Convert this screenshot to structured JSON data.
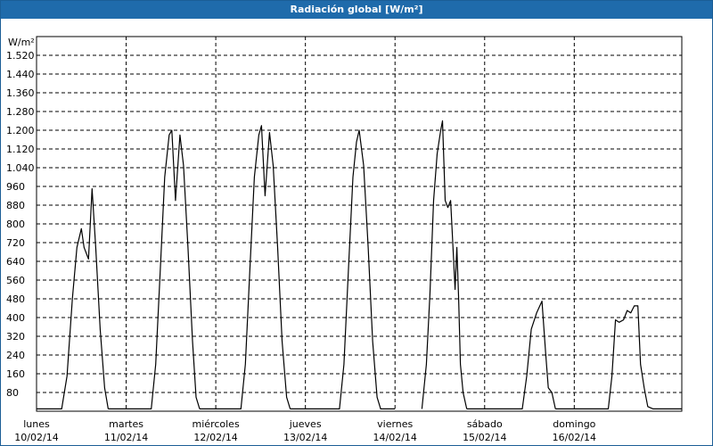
{
  "window": {
    "title": "Radiación global [W/m²]"
  },
  "chart_data": {
    "type": "line",
    "title": "Radiación global [W/m²]",
    "ylabel": "W/m²",
    "ylim": [
      0,
      1600
    ],
    "xlim": [
      0,
      7.2
    ],
    "grid": true,
    "yticks": [
      {
        "value": 80,
        "label": "80"
      },
      {
        "value": 160,
        "label": "160"
      },
      {
        "value": 240,
        "label": "240"
      },
      {
        "value": 320,
        "label": "320"
      },
      {
        "value": 400,
        "label": "400"
      },
      {
        "value": 480,
        "label": "480"
      },
      {
        "value": 560,
        "label": "560"
      },
      {
        "value": 640,
        "label": "640"
      },
      {
        "value": 720,
        "label": "720"
      },
      {
        "value": 800,
        "label": "800"
      },
      {
        "value": 880,
        "label": "880"
      },
      {
        "value": 960,
        "label": "960"
      },
      {
        "value": 1040,
        "label": "1.040"
      },
      {
        "value": 1120,
        "label": "1.120"
      },
      {
        "value": 1200,
        "label": "1.200"
      },
      {
        "value": 1280,
        "label": "1.280"
      },
      {
        "value": 1360,
        "label": "1.360"
      },
      {
        "value": 1440,
        "label": "1.440"
      },
      {
        "value": 1520,
        "label": "1.520"
      }
    ],
    "xticks": [
      {
        "pos": 0,
        "day": "lunes",
        "date": "10/02/14"
      },
      {
        "pos": 1,
        "day": "martes",
        "date": "11/02/14"
      },
      {
        "pos": 2,
        "day": "miércoles",
        "date": "12/02/14"
      },
      {
        "pos": 3,
        "day": "jueves",
        "date": "13/02/14"
      },
      {
        "pos": 4,
        "day": "viernes",
        "date": "14/02/14"
      },
      {
        "pos": 5,
        "day": "sábado",
        "date": "15/02/14"
      },
      {
        "pos": 6,
        "day": "domingo",
        "date": "16/02/14"
      }
    ],
    "series": [
      {
        "color": "#000000",
        "segments": [
          [
            [
              0,
              10
            ],
            [
              0.28,
              10
            ],
            [
              0.34,
              150
            ],
            [
              0.4,
              480
            ],
            [
              0.45,
              700
            ],
            [
              0.5,
              780
            ],
            [
              0.53,
              700
            ],
            [
              0.58,
              650
            ],
            [
              0.62,
              950
            ],
            [
              0.66,
              700
            ],
            [
              0.71,
              350
            ],
            [
              0.76,
              100
            ],
            [
              0.8,
              10
            ]
          ],
          [
            [
              0.8,
              10
            ],
            [
              1.28,
              10
            ],
            [
              1.33,
              200
            ],
            [
              1.38,
              600
            ],
            [
              1.43,
              1000
            ],
            [
              1.48,
              1180
            ],
            [
              1.51,
              1200
            ],
            [
              1.55,
              900
            ],
            [
              1.6,
              1180
            ],
            [
              1.64,
              1050
            ],
            [
              1.69,
              700
            ],
            [
              1.74,
              300
            ],
            [
              1.78,
              60
            ],
            [
              1.82,
              10
            ]
          ],
          [
            [
              1.82,
              10
            ],
            [
              2.28,
              10
            ],
            [
              2.33,
              200
            ],
            [
              2.38,
              600
            ],
            [
              2.43,
              1000
            ],
            [
              2.48,
              1180
            ],
            [
              2.51,
              1220
            ],
            [
              2.55,
              920
            ],
            [
              2.6,
              1190
            ],
            [
              2.64,
              1050
            ],
            [
              2.69,
              700
            ],
            [
              2.74,
              300
            ],
            [
              2.79,
              60
            ],
            [
              2.83,
              10
            ]
          ],
          [
            [
              2.83,
              10
            ],
            [
              3.38,
              10
            ],
            [
              3.43,
              200
            ],
            [
              3.48,
              600
            ],
            [
              3.53,
              1000
            ],
            [
              3.57,
              1150
            ],
            [
              3.6,
              1200
            ],
            [
              3.65,
              1050
            ],
            [
              3.7,
              700
            ],
            [
              3.75,
              300
            ],
            [
              3.8,
              60
            ],
            [
              3.84,
              10
            ],
            [
              4.0,
              10
            ]
          ],
          [
            [
              4.3,
              10
            ],
            [
              4.35,
              200
            ],
            [
              4.39,
              500
            ],
            [
              4.43,
              900
            ],
            [
              4.47,
              1100
            ],
            [
              4.51,
              1200
            ],
            [
              4.53,
              1240
            ],
            [
              4.56,
              900
            ],
            [
              4.59,
              870
            ],
            [
              4.62,
              900
            ],
            [
              4.64,
              750
            ],
            [
              4.67,
              520
            ],
            [
              4.69,
              700
            ],
            [
              4.71,
              480
            ],
            [
              4.73,
              200
            ],
            [
              4.76,
              80
            ],
            [
              4.8,
              10
            ]
          ],
          [
            [
              4.8,
              10
            ],
            [
              5.42,
              10
            ],
            [
              5.47,
              150
            ],
            [
              5.52,
              350
            ],
            [
              5.58,
              420
            ],
            [
              5.64,
              470
            ],
            [
              5.68,
              250
            ],
            [
              5.71,
              100
            ],
            [
              5.75,
              80
            ],
            [
              5.79,
              10
            ]
          ],
          [
            [
              5.79,
              10
            ],
            [
              6.38,
              10
            ],
            [
              6.42,
              150
            ],
            [
              6.46,
              390
            ],
            [
              6.5,
              380
            ],
            [
              6.55,
              390
            ],
            [
              6.59,
              430
            ],
            [
              6.63,
              420
            ],
            [
              6.67,
              450
            ],
            [
              6.71,
              450
            ],
            [
              6.74,
              200
            ],
            [
              6.78,
              100
            ],
            [
              6.82,
              20
            ],
            [
              6.88,
              10
            ],
            [
              7.2,
              10
            ]
          ]
        ]
      }
    ]
  }
}
